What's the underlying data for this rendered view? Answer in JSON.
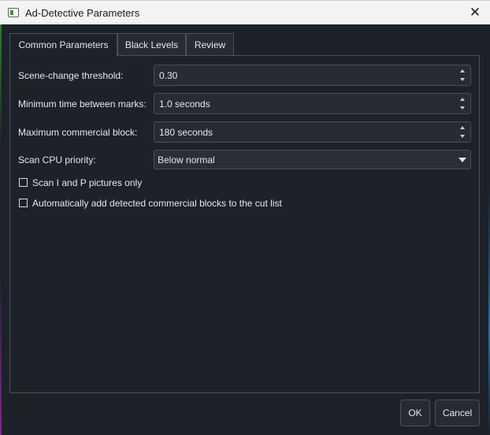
{
  "window": {
    "title": "Ad-Detective Parameters",
    "close_glyph": "✕"
  },
  "tabs": [
    {
      "label": "Common Parameters",
      "active": true
    },
    {
      "label": "Black Levels",
      "active": false
    },
    {
      "label": "Review",
      "active": false
    }
  ],
  "fields": {
    "scene_change": {
      "label": "Scene-change threshold:",
      "value": "0.30"
    },
    "min_time": {
      "label": "Minimum time between marks:",
      "value": "1.0 seconds"
    },
    "max_block": {
      "label": "Maximum commercial block:",
      "value": "180 seconds"
    },
    "cpu_priority": {
      "label": "Scan CPU priority:",
      "value": "Below normal"
    }
  },
  "checkboxes": {
    "scan_ip": {
      "label": "Scan I and P pictures only",
      "checked": false
    },
    "auto_add": {
      "label": "Automatically add detected commercial blocks to the cut list",
      "checked": false
    }
  },
  "buttons": {
    "ok": "OK",
    "cancel": "Cancel"
  },
  "colors": {
    "background": "#1d2129",
    "titlebar": "#f3f3f3",
    "input_bg": "#272b33",
    "border": "#4c5058"
  }
}
